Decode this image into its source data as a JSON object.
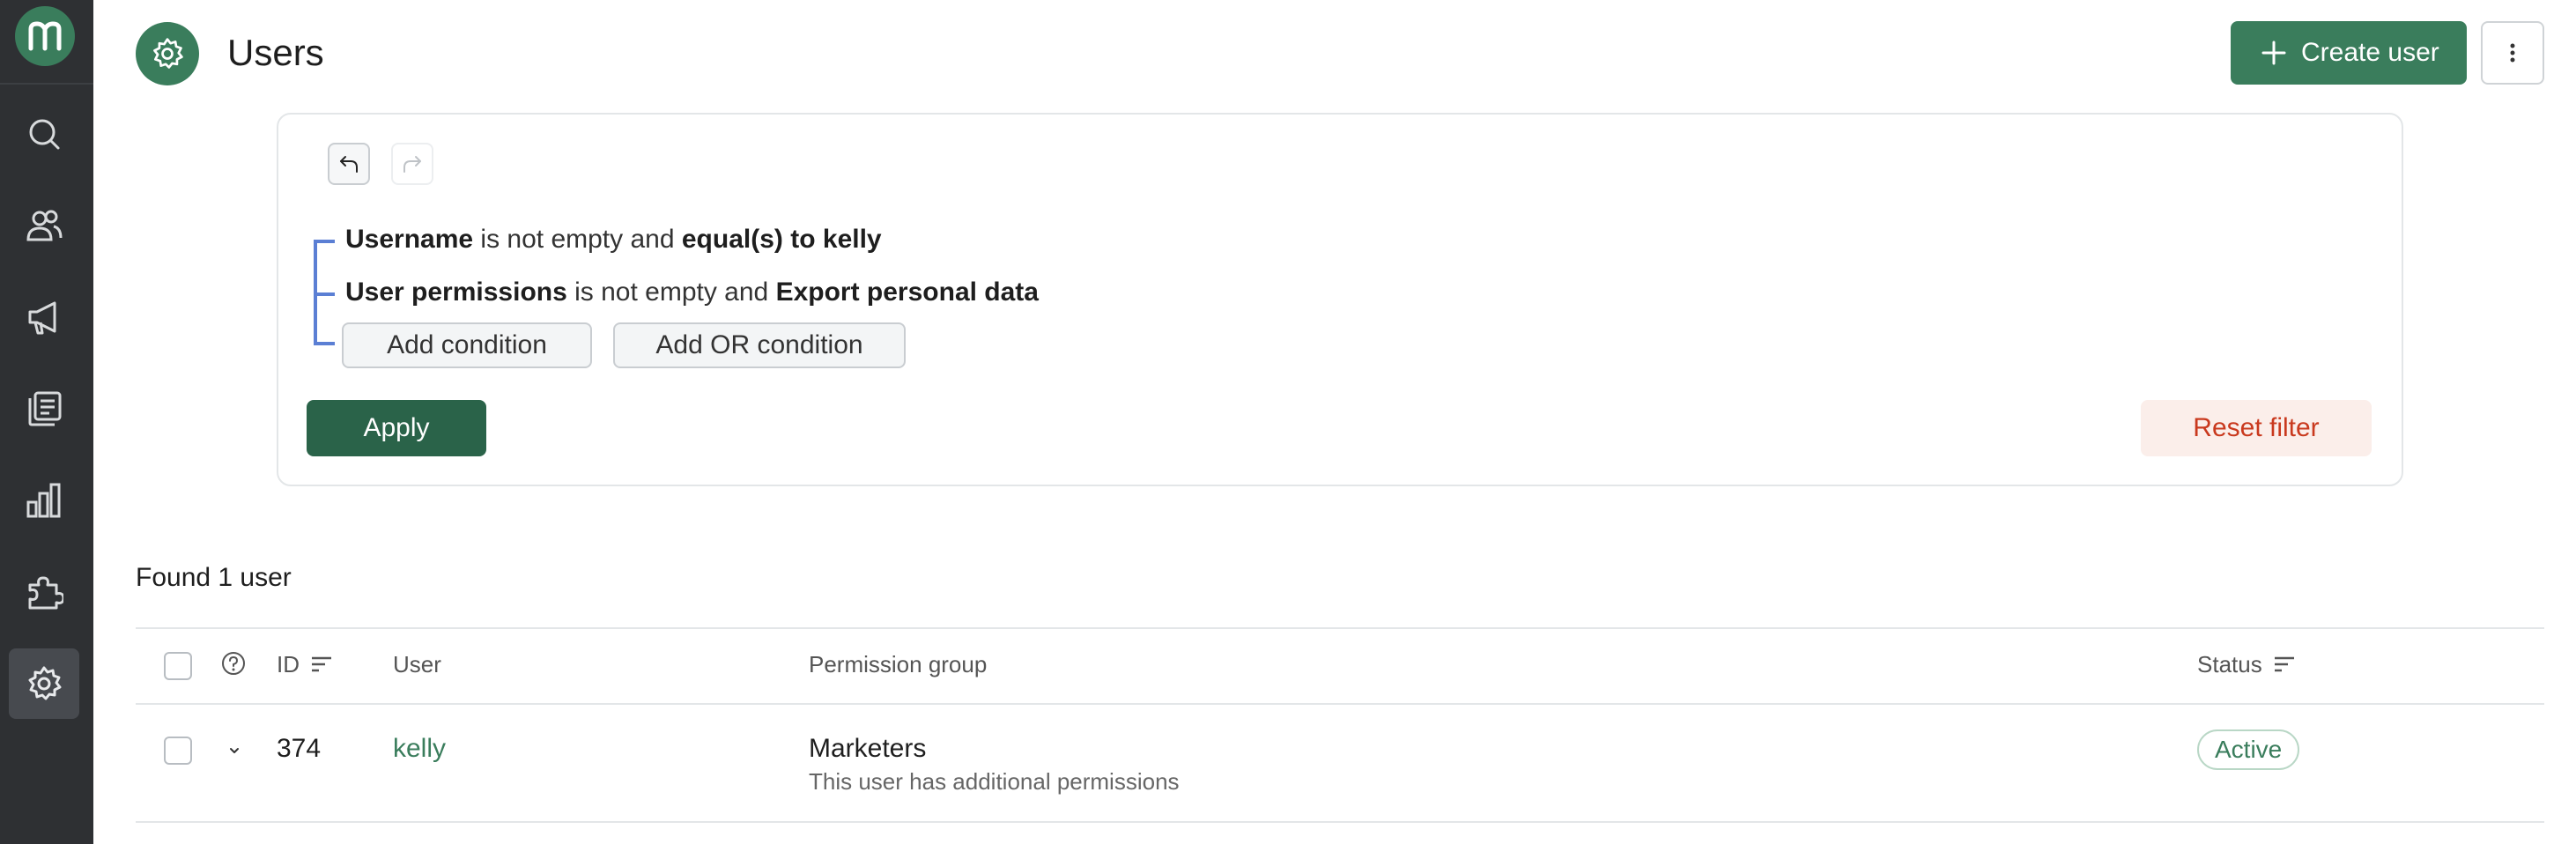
{
  "app": {
    "logo_letter": "m",
    "accent_color": "#3a7d5c",
    "sidebar_color": "#2e3033"
  },
  "sidebar": {
    "items": [
      {
        "icon": "search-icon"
      },
      {
        "icon": "users-icon"
      },
      {
        "icon": "megaphone-icon"
      },
      {
        "icon": "campaigns-icon"
      },
      {
        "icon": "analytics-icon"
      },
      {
        "icon": "puzzle-icon"
      },
      {
        "icon": "gear-icon",
        "active": true
      }
    ]
  },
  "header": {
    "title": "Users",
    "create_label": "Create user"
  },
  "filter": {
    "conditions": [
      {
        "field": "Username",
        "op": " is not empty and ",
        "value": "equal(s) to kelly"
      },
      {
        "field": "User permissions",
        "op": " is not empty and ",
        "value": "Export personal data"
      }
    ],
    "add_condition_label": "Add condition",
    "add_or_condition_label": "Add OR condition",
    "apply_label": "Apply",
    "reset_label": "Reset filter"
  },
  "results": {
    "found_text": "Found 1 user",
    "columns": {
      "id": "ID",
      "user": "User",
      "permission_group": "Permission group",
      "status": "Status"
    },
    "rows": [
      {
        "id": "374",
        "user": "kelly",
        "permission_group": "Marketers",
        "permission_note": "This user has additional permissions",
        "status": "Active"
      }
    ]
  }
}
